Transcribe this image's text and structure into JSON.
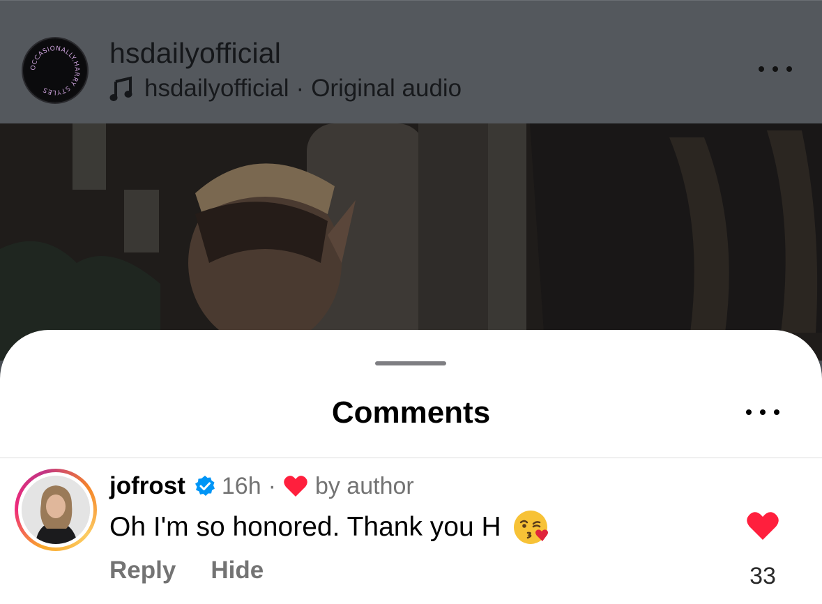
{
  "post": {
    "username": "hsdailyofficial",
    "audio_owner": "hsdailyofficial",
    "audio_separator": "·",
    "audio_label": "Original audio",
    "avatar_text": "OCCASIONALLY.HARRY STYLES"
  },
  "sheet": {
    "title": "Comments"
  },
  "comment": {
    "username": "jofrost",
    "time": "16h",
    "separator": "·",
    "liked_by": "by author",
    "text": "Oh I'm so honored. Thank you H",
    "emoji": "kissing-face-with-heart",
    "reply_label": "Reply",
    "hide_label": "Hide",
    "like_count": "33",
    "liked": true
  },
  "colors": {
    "heart": "#ff1f3d",
    "verified": "#0095f6",
    "secondary_text": "#737373"
  },
  "icons": [
    "music-note-icon",
    "more-dots-icon",
    "verified-badge-icon",
    "heart-icon",
    "kiss-emoji-icon"
  ]
}
